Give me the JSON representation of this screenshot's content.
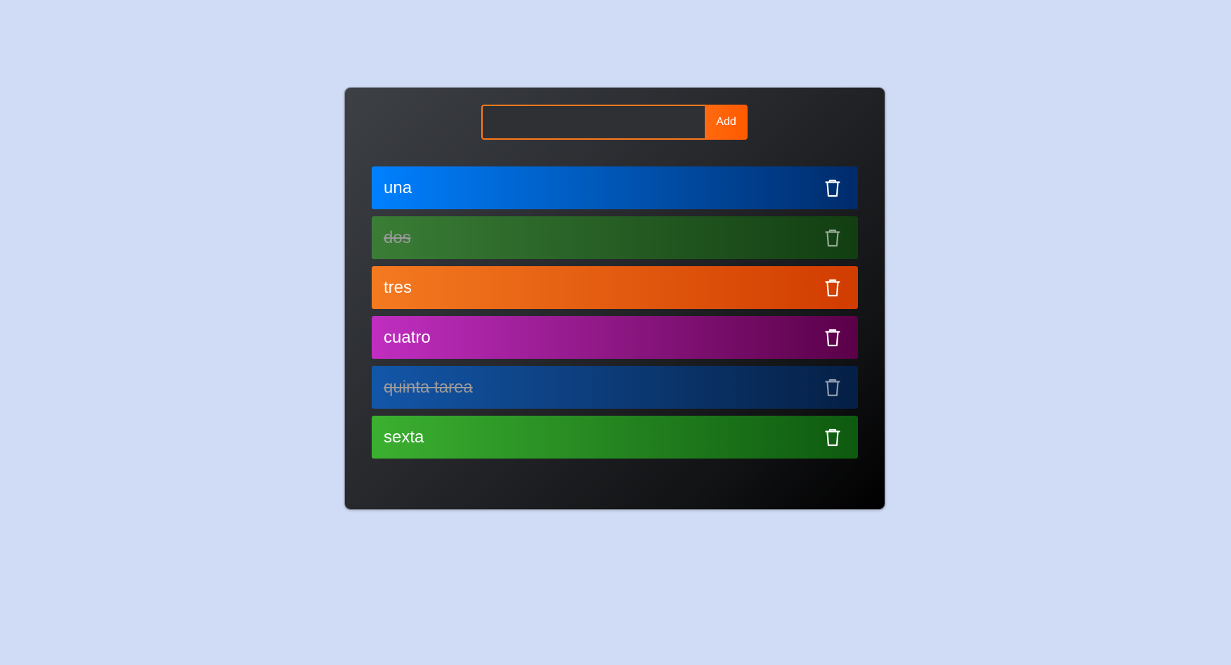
{
  "form": {
    "input_value": "",
    "input_placeholder": "",
    "add_label": "Add"
  },
  "tasks": [
    {
      "text": "una",
      "done": false,
      "gradient": [
        "#0080ff",
        "#002b6b"
      ]
    },
    {
      "text": "dos",
      "done": true,
      "gradient": [
        "#3a7d36",
        "#123e12"
      ]
    },
    {
      "text": "tres",
      "done": false,
      "gradient": [
        "#f47a20",
        "#d13c00"
      ]
    },
    {
      "text": "cuatro",
      "done": false,
      "gradient": [
        "#c02ec0",
        "#5a0048"
      ]
    },
    {
      "text": "quinta tarea",
      "done": true,
      "gradient": [
        "#1356a8",
        "#051f45"
      ]
    },
    {
      "text": "sexta",
      "done": false,
      "gradient": [
        "#3bb030",
        "#0e5a10"
      ]
    }
  ],
  "icons": {
    "delete": "trash-icon"
  }
}
